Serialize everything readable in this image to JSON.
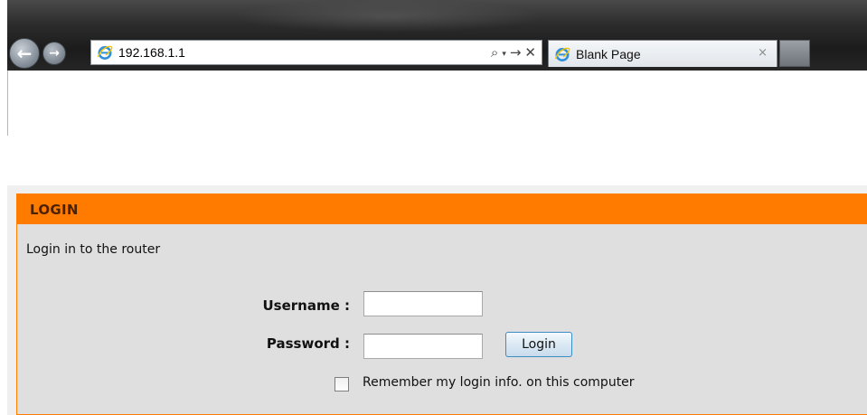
{
  "browser": {
    "address_url": "192.168.1.1",
    "tab_title": "Blank Page",
    "tab_close_glyph": "×",
    "addr_search_glyph": "⌕",
    "addr_dropdown_glyph": "▾",
    "addr_go_glyph": "→",
    "addr_stop_glyph": "✕",
    "back_glyph": "←",
    "forward_glyph": "→",
    "icons": {
      "back": "back-arrow-icon",
      "forward": "forward-arrow-icon",
      "site": "internet-explorer-icon",
      "search": "search-icon",
      "dropdown": "chevron-down-icon",
      "go": "go-arrow-icon",
      "stop": "close-icon"
    }
  },
  "login": {
    "title": "LOGIN",
    "subtitle": "Login in to the router",
    "username_label": "Username :",
    "password_label": "Password :",
    "username_value": "",
    "password_value": "",
    "login_button": "Login",
    "remember_label": "Remember my login info. on this computer",
    "remember_checked": false
  },
  "colors": {
    "header_orange": "#ff7b00",
    "panel_gray": "#dfdfdf",
    "button_border": "#3c8dc4"
  }
}
